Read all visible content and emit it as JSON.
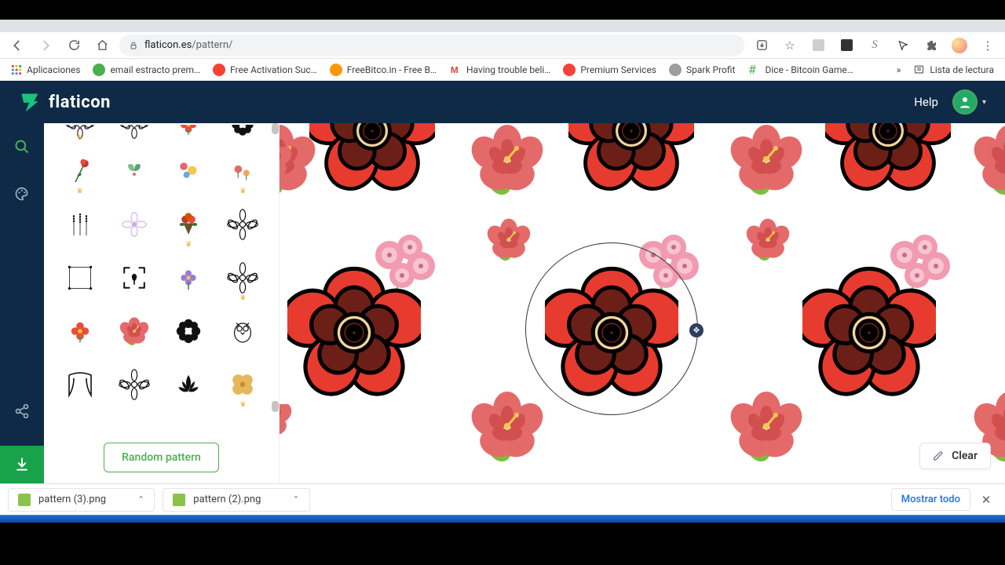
{
  "chrome": {
    "url_host": "flaticon.es",
    "url_path": "/pattern/",
    "bookmarks_label": "Aplicaciones",
    "bookmarks": [
      {
        "label": "email estracto prem…",
        "color": "#4caf50"
      },
      {
        "label": "Free Activation Suc…",
        "color": "#f44336"
      },
      {
        "label": "FreeBitco.in - Free B…",
        "color": "#ff9800"
      },
      {
        "label": "Having trouble beli…",
        "color": "#ea4335"
      },
      {
        "label": "Premium Services",
        "color": "#f44336"
      },
      {
        "label": "Spark Profit",
        "color": "#9e9e9e"
      },
      {
        "label": "Dice - Bitcoin Game…",
        "color": "#4caf50"
      }
    ],
    "overflow_glyph": "»",
    "reading_list": "Lista de lectura"
  },
  "header": {
    "brand": "flaticon",
    "help": "Help"
  },
  "sidebar": {
    "random_pattern": "Random pattern"
  },
  "canvas": {
    "clear": "Clear"
  },
  "downloads": {
    "items": [
      "pattern (3).png",
      "pattern (2).png"
    ],
    "show_all": "Mostrar todo"
  }
}
